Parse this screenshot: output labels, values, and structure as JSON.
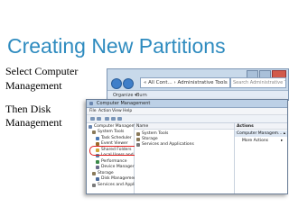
{
  "slide": {
    "title": "Creating New Partitions",
    "caption_lines": [
      "Select Computer",
      "Management",
      "Then Disk",
      "Management"
    ]
  },
  "explorer": {
    "address": "« All Cont... › Administrative Tools",
    "search_placeholder": "Search Administrative Tools",
    "toolbar": [
      "Organize ▾",
      "Burn"
    ]
  },
  "computer_management": {
    "title": "Computer Management",
    "menu": [
      "File",
      "Action",
      "View",
      "Help"
    ],
    "tree_root": "Computer Management",
    "tree": [
      {
        "label": "System Tools",
        "indent": 1,
        "color": "#8a7a5a"
      },
      {
        "label": "Task Scheduler",
        "indent": 2,
        "color": "#4a78b5"
      },
      {
        "label": "Event Viewer",
        "indent": 2,
        "color": "#9b6a2a"
      },
      {
        "label": "Shared Folders",
        "indent": 2,
        "color": "#d1a63a"
      },
      {
        "label": "Local Users and Gr",
        "indent": 2,
        "color": "#5b7fa8"
      },
      {
        "label": "Performance",
        "indent": 2,
        "color": "#3b8a4a"
      },
      {
        "label": "Device Manager",
        "indent": 2,
        "color": "#6a6a8a"
      },
      {
        "label": "Storage",
        "indent": 1,
        "color": "#8a7a5a"
      },
      {
        "label": "Disk Management",
        "indent": 2,
        "color": "#4a6a9a"
      },
      {
        "label": "Services and Applicat",
        "indent": 1,
        "color": "#7a7a7a"
      }
    ],
    "list_header": "Name",
    "list_items": [
      "System Tools",
      "Storage",
      "Services and Applications"
    ],
    "actions_header": "Actions",
    "actions_context": "Computer Managem...",
    "more_actions": "More Actions",
    "highlight_color": "#e02020"
  }
}
